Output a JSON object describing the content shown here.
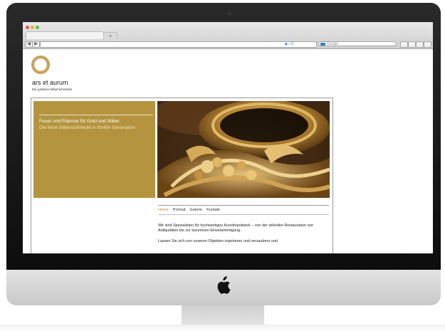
{
  "browser": {
    "new_tab_label": "+",
    "back_label": "◀",
    "forward_label": "▶",
    "search_placeholder": "Google",
    "url_icons": "◆ ▿ C"
  },
  "site": {
    "brand_name": "ars et aurum",
    "tagline": "Die goldene Silberschmiede",
    "headline": "Feuer und Flamme für Gold und Silber",
    "subheadline": "Die feine Silberschmiede in fünfter Generation",
    "nav": [
      "Home",
      "Portrait",
      "Galerie",
      "Kontakt"
    ],
    "active_nav": "Home",
    "intro_text": "Wir sind Spezialisten für hochwertiges Kunsthandwerk – von der stilvollen Restauration von Antiquitäten bis zur luxuriösen Einzelanfertigung.",
    "second_text": "Lassen Sie sich von unseren Objekten inspirieren und verzaubern und"
  },
  "colors": {
    "gold_accent": "#b4943f",
    "logo_gold": "#c8a35a",
    "bezel": "#111111"
  }
}
